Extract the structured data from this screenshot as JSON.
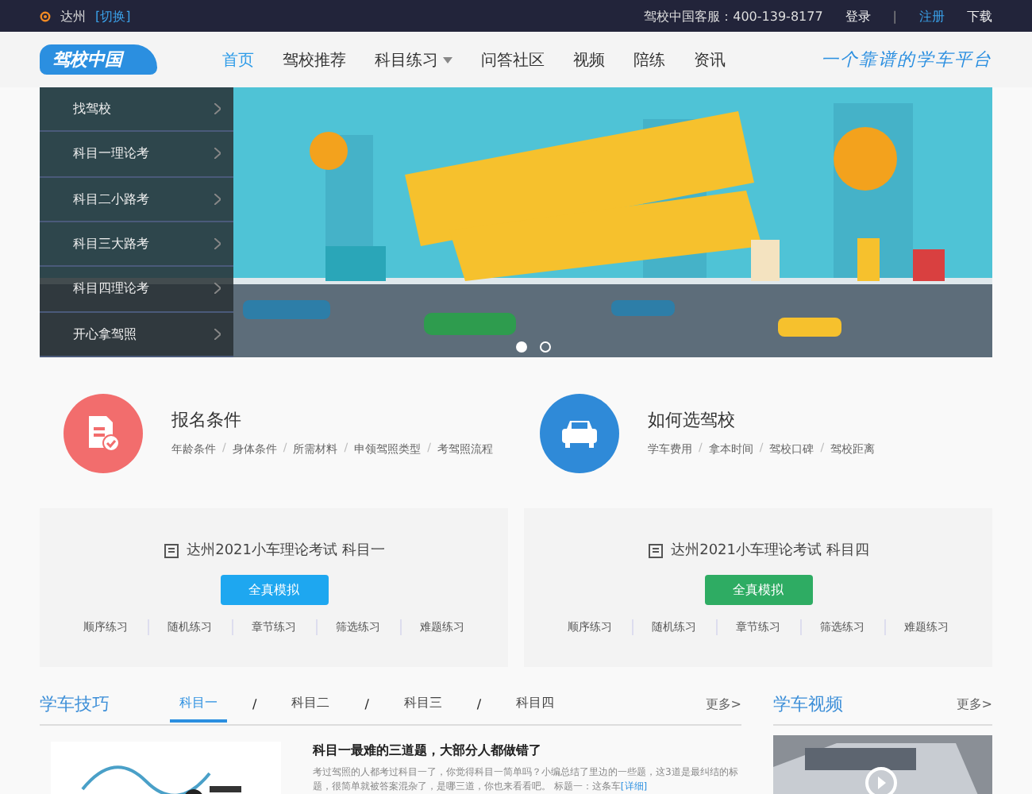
{
  "topbar": {
    "city": "达州",
    "switch": "[切换]",
    "hotline": "驾校中国客服：400-139-8177",
    "links": [
      {
        "label": "登录",
        "kind": "plain"
      },
      {
        "label": "|",
        "kind": "sep"
      },
      {
        "label": "注册",
        "kind": "accent"
      },
      {
        "label": "下载",
        "kind": "plain"
      }
    ]
  },
  "header": {
    "logo": "驾校中国",
    "slogan": "一个靠谱的学车平台",
    "nav": [
      {
        "label": "首页",
        "selected": true,
        "dropdown": false
      },
      {
        "label": "驾校推荐",
        "selected": false,
        "dropdown": false
      },
      {
        "label": "科目练习",
        "selected": false,
        "dropdown": true
      },
      {
        "label": "问答社区",
        "selected": false,
        "dropdown": false
      },
      {
        "label": "视频",
        "selected": false,
        "dropdown": false
      },
      {
        "label": "陪练",
        "selected": false,
        "dropdown": false
      },
      {
        "label": "资讯",
        "selected": false,
        "dropdown": false
      }
    ]
  },
  "banner": {
    "menu": [
      "找驾校",
      "科目一理论考",
      "科目二小路考",
      "科目三大路考",
      "科目四理论考",
      "开心拿驾照"
    ],
    "dots": [
      {
        "selected": true
      },
      {
        "selected": false
      }
    ]
  },
  "features": [
    {
      "title": "报名条件",
      "kind": "document",
      "color": "#f26d6d",
      "links": [
        {
          "kind": "link",
          "label": "年龄条件"
        },
        {
          "kind": "sep",
          "label": "/"
        },
        {
          "kind": "link",
          "label": "身体条件"
        },
        {
          "kind": "sep",
          "label": "/"
        },
        {
          "kind": "link",
          "label": "所需材料"
        },
        {
          "kind": "sep",
          "label": "/"
        },
        {
          "kind": "link",
          "label": "申领驾照类型"
        },
        {
          "kind": "sep",
          "label": "/"
        },
        {
          "kind": "link",
          "label": "考驾照流程"
        }
      ]
    },
    {
      "title": "如何选驾校",
      "kind": "car",
      "color": "#2f8ad8",
      "links": [
        {
          "kind": "link",
          "label": "学车费用"
        },
        {
          "kind": "sep",
          "label": "/"
        },
        {
          "kind": "link",
          "label": "拿本时间"
        },
        {
          "kind": "sep",
          "label": "/"
        },
        {
          "kind": "link",
          "label": "驾校口碑"
        },
        {
          "kind": "sep",
          "label": "/"
        },
        {
          "kind": "link",
          "label": "驾校距离"
        }
      ]
    }
  ],
  "exams": [
    {
      "title": "达州2021小车理论考试 科目一",
      "button": "全真模拟",
      "color": "#1ea7f0",
      "links": [
        "顺序练习",
        "随机练习",
        "章节练习",
        "筛选练习",
        "难题练习"
      ]
    },
    {
      "title": "达州2021小车理论考试 科目四",
      "button": "全真模拟",
      "color": "#2eac63",
      "links": [
        "顺序练习",
        "随机练习",
        "章节练习",
        "筛选练习",
        "难题练习"
      ]
    }
  ],
  "tips": {
    "title": "学车技巧",
    "more": "更多>",
    "tabs": [
      {
        "kind": "tab",
        "label": "科目一",
        "selected": true
      },
      {
        "kind": "sep",
        "label": "/"
      },
      {
        "kind": "tab",
        "label": "科目二",
        "selected": false
      },
      {
        "kind": "sep",
        "label": "/"
      },
      {
        "kind": "tab",
        "label": "科目三",
        "selected": false
      },
      {
        "kind": "sep",
        "label": "/"
      },
      {
        "kind": "tab",
        "label": "科目四",
        "selected": false
      }
    ],
    "article": {
      "title": "科目一最难的三道题，大部分人都做错了",
      "text": "考过驾照的人都考过科目一了，你觉得科目一简单吗？小编总结了里边的一些题，这3道是最纠结的标题，很简单就被答案混杂了，是哪三道，你也来看看吧。 标题一：这条车",
      "link": "[详细]"
    }
  },
  "videos": {
    "title": "学车视频",
    "more": "更多>"
  }
}
